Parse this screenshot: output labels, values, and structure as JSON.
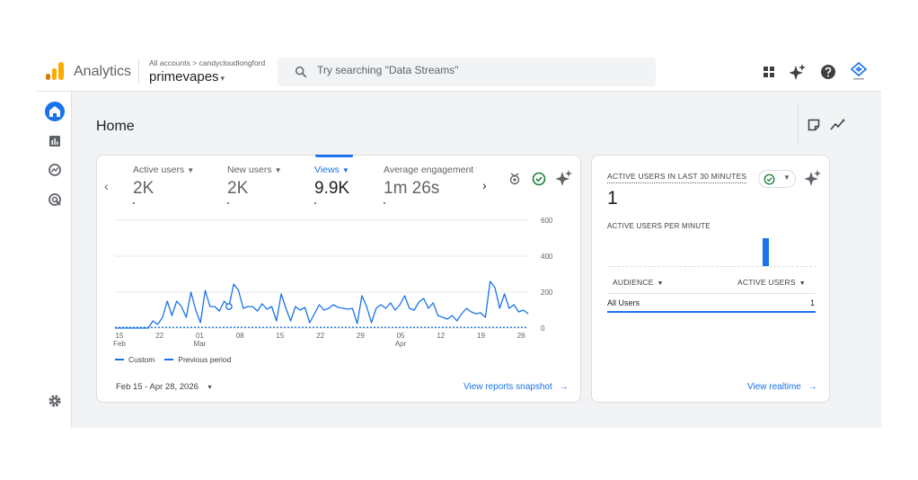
{
  "app": {
    "name": "Analytics",
    "breadcrumb": "All accounts > candycloudlongford",
    "property": "primevapes",
    "property_caret": "▾"
  },
  "search": {
    "placeholder": "Try searching \"Data Streams\""
  },
  "page": {
    "title": "Home"
  },
  "metrics": [
    {
      "label": "Active users",
      "value": "2K",
      "selected": false
    },
    {
      "label": "New users",
      "value": "2K",
      "selected": false
    },
    {
      "label": "Views",
      "value": "9.9K",
      "selected": true
    },
    {
      "label": "Average engagement t",
      "value": "1m 26s",
      "selected": false
    }
  ],
  "chart_data": {
    "type": "line",
    "x_tick_labels": [
      {
        "day": "15",
        "month": "Feb"
      },
      {
        "day": "22",
        "month": ""
      },
      {
        "day": "01",
        "month": "Mar"
      },
      {
        "day": "08",
        "month": ""
      },
      {
        "day": "15",
        "month": ""
      },
      {
        "day": "22",
        "month": ""
      },
      {
        "day": "29",
        "month": ""
      },
      {
        "day": "05",
        "month": "Apr"
      },
      {
        "day": "12",
        "month": ""
      },
      {
        "day": "19",
        "month": ""
      },
      {
        "day": "26",
        "month": ""
      }
    ],
    "y_ticks": [
      0,
      200,
      400,
      600
    ],
    "ylim": [
      0,
      600
    ],
    "grid": true,
    "highlight_index": 24,
    "series": [
      {
        "name": "Custom",
        "style": "solid",
        "color": "#1a73e8",
        "values": [
          0,
          0,
          0,
          0,
          0,
          0,
          0,
          0,
          40,
          20,
          60,
          150,
          70,
          150,
          120,
          60,
          200,
          100,
          30,
          210,
          120,
          120,
          95,
          150,
          120,
          245,
          210,
          110,
          120,
          120,
          95,
          135,
          105,
          120,
          40,
          190,
          110,
          40,
          120,
          100,
          115,
          30,
          80,
          130,
          100,
          110,
          130,
          115,
          110,
          105,
          110,
          25,
          180,
          120,
          30,
          110,
          130,
          110,
          140,
          100,
          130,
          180,
          110,
          100,
          145,
          165,
          110,
          140,
          70,
          60,
          50,
          70,
          40,
          80,
          110,
          90,
          80,
          85,
          60,
          260,
          225,
          110,
          190,
          110,
          130,
          90,
          100,
          80
        ]
      },
      {
        "name": "Previous period",
        "style": "dashed",
        "color": "#1a73e8",
        "values": [
          4,
          4,
          4,
          4,
          4,
          4,
          4,
          4,
          4,
          4,
          4,
          4,
          4,
          4,
          4,
          4,
          4,
          4,
          4,
          4,
          4,
          4,
          4,
          4,
          4,
          4,
          4,
          4,
          4,
          4,
          4,
          4,
          4,
          4,
          4,
          4,
          4,
          4,
          4,
          4,
          4,
          4,
          4,
          4,
          4,
          4,
          4,
          4,
          4,
          4,
          4,
          4,
          4,
          4,
          4,
          4,
          4,
          4,
          4,
          4,
          4,
          4,
          4,
          4,
          4,
          4,
          4,
          4,
          4,
          4,
          4,
          4,
          4,
          4,
          4,
          4,
          4,
          4,
          4,
          4,
          4,
          4,
          4,
          4,
          4,
          4,
          4,
          4
        ]
      }
    ]
  },
  "legend": {
    "custom": "Custom",
    "previous": "Previous period"
  },
  "date_range": {
    "label": "Feb 15 - Apr 28, 2026",
    "caret": "▾"
  },
  "links": {
    "snapshot": "View reports snapshot",
    "realtime": "View realtime",
    "arrow": "→"
  },
  "realtime": {
    "title": "ACTIVE USERS IN LAST 30 MINUTES",
    "value": "1",
    "per_minute_title": "ACTIVE USERS PER MINUTE",
    "per_minute_values": [
      0,
      0,
      0,
      0,
      0,
      0,
      0,
      0,
      0,
      0,
      0,
      0,
      0,
      0,
      0,
      0,
      0,
      0,
      0,
      0,
      0,
      0,
      1,
      0,
      0,
      0,
      0,
      0,
      0,
      0
    ],
    "table": {
      "col1": "AUDIENCE",
      "col2": "ACTIVE USERS",
      "rows": [
        {
          "audience": "All Users",
          "users": "1"
        }
      ]
    }
  },
  "icons": {
    "search": "search-icon",
    "apps": "apps-grid-icon",
    "sparkle": "sparkle-icon",
    "help": "help-icon",
    "account": "account-logo-icon",
    "home": "home-icon",
    "reports": "reports-icon",
    "explore": "explore-icon",
    "advertising": "advertising-icon",
    "settings": "gear-icon"
  },
  "colors": {
    "accent": "#1a73e8",
    "logo_orange": "#f9ab00",
    "logo_dark": "#e37400",
    "success": "#188038"
  }
}
